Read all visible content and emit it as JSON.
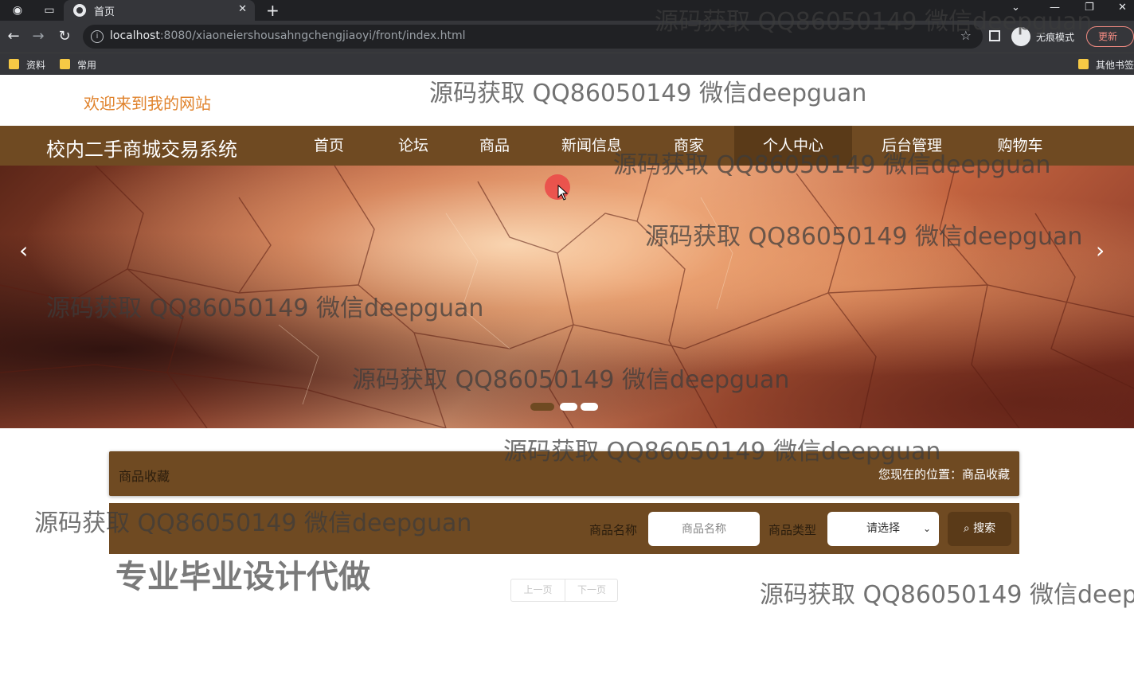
{
  "browser": {
    "tab_title": "首页",
    "url_host": "localhost",
    "url_path": ":8080/xiaoneiershousahngchengjiaoyi/front/index.html",
    "incognito_label": "无痕模式",
    "update_label": "更新",
    "bookmarks": [
      "资料",
      "常用"
    ],
    "other_bookmarks": "其他书签"
  },
  "site": {
    "welcome": "欢迎来到我的网站",
    "brand": "校内二手商城交易系统",
    "nav": [
      "首页",
      "论坛",
      "商品",
      "新闻信息",
      "商家",
      "个人中心",
      "后台管理",
      "购物车"
    ],
    "active_nav": "个人中心",
    "banner": {
      "slides": 3,
      "active_slide": 1
    }
  },
  "breadcrumb": {
    "title": "商品收藏",
    "location": "您现在的位置：商品收藏"
  },
  "search": {
    "name_label": "商品名称",
    "name_placeholder": "商品名称",
    "type_label": "商品类型",
    "type_value": "请选择",
    "button_label": "搜索"
  },
  "pager": {
    "prev": "上一页",
    "next": "下一页"
  },
  "promo": "专业毕业设计代做",
  "watermark": "源码获取 QQ86050149 微信deepguan",
  "colors": {
    "nav_bg": "#6f4a22",
    "accent": "#e0832d"
  }
}
